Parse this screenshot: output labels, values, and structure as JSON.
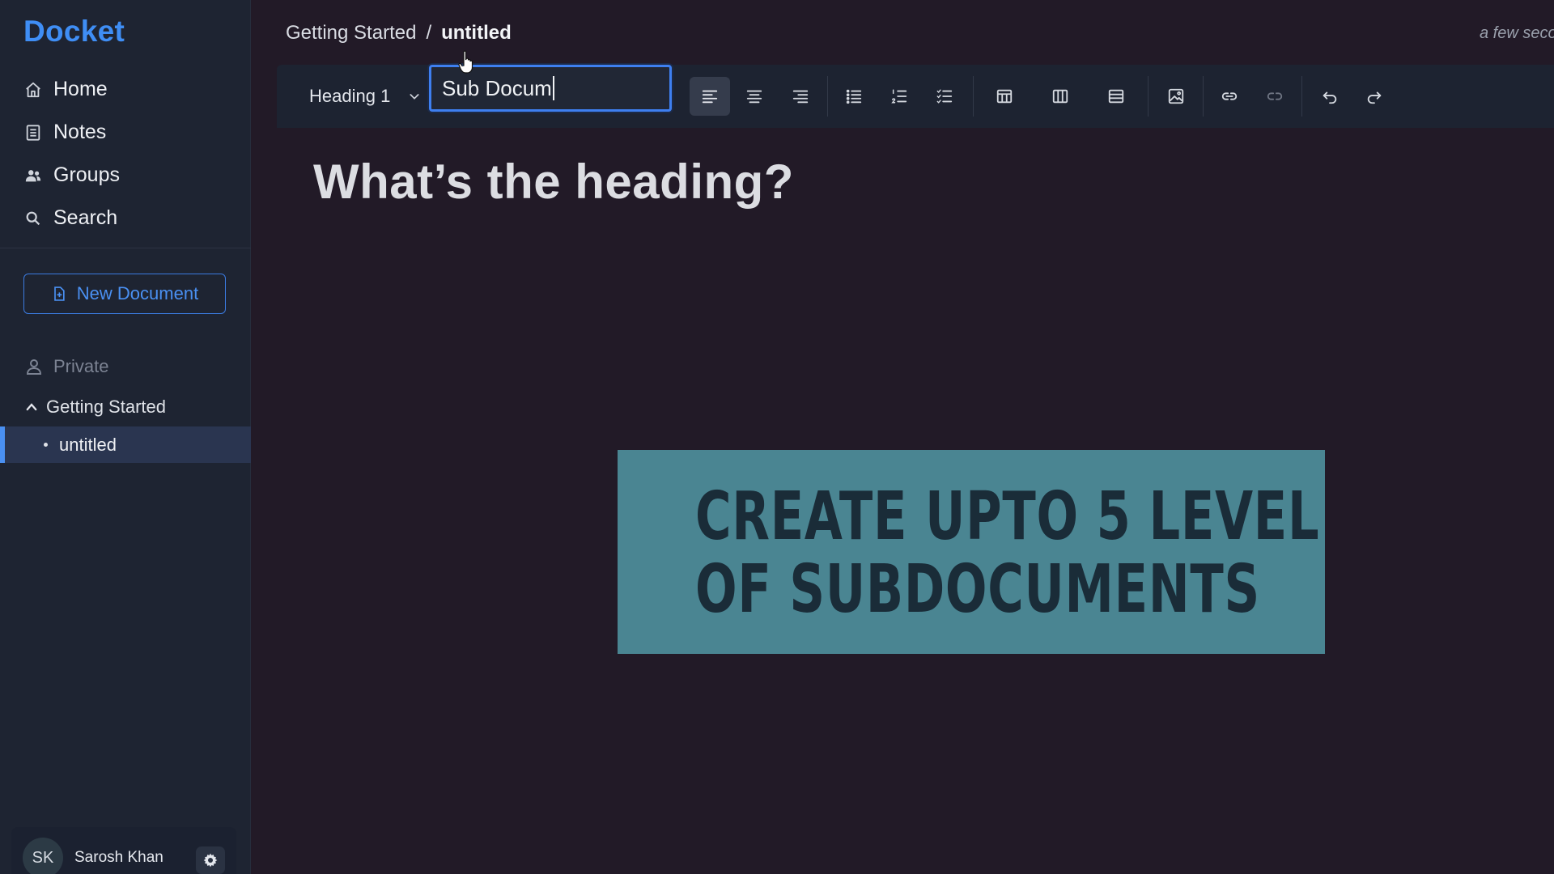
{
  "app": {
    "name": "Docket"
  },
  "sidebar": {
    "nav": [
      {
        "label": "Home",
        "icon": "home-icon"
      },
      {
        "label": "Notes",
        "icon": "notes-icon"
      },
      {
        "label": "Groups",
        "icon": "groups-icon"
      },
      {
        "label": "Search",
        "icon": "search-icon"
      }
    ],
    "new_document_label": "New Document",
    "section_label": "Private",
    "tree": {
      "parent": "Getting Started",
      "child": "untitled"
    },
    "user": {
      "initials": "SK",
      "name": "Sarosh Khan"
    }
  },
  "header": {
    "breadcrumb": {
      "parent": "Getting Started",
      "separator": "/",
      "current": "untitled"
    },
    "status": "a few secon"
  },
  "toolbar": {
    "block_type": "Heading 1",
    "title_value": "Sub Docum",
    "buttons": [
      "align-left-icon",
      "align-center-icon",
      "align-right-icon",
      "bullet-list-icon",
      "ordered-list-icon",
      "task-list-icon",
      "table-icon",
      "columns-icon",
      "rows-icon",
      "image-icon",
      "link-icon",
      "unlink-icon",
      "undo-icon",
      "redo-icon"
    ]
  },
  "editor": {
    "heading": "What’s the heading?"
  },
  "banner": {
    "line1": "CREATE UPTO 5 LEVEL",
    "line2": "OF SUBDOCUMENTS"
  },
  "colors": {
    "accent": "#3f8ef5",
    "sidebar_bg": "#1e2432",
    "editor_bg": "#221a27",
    "banner_bg": "#4a8592",
    "banner_text": "#1a2c38"
  }
}
